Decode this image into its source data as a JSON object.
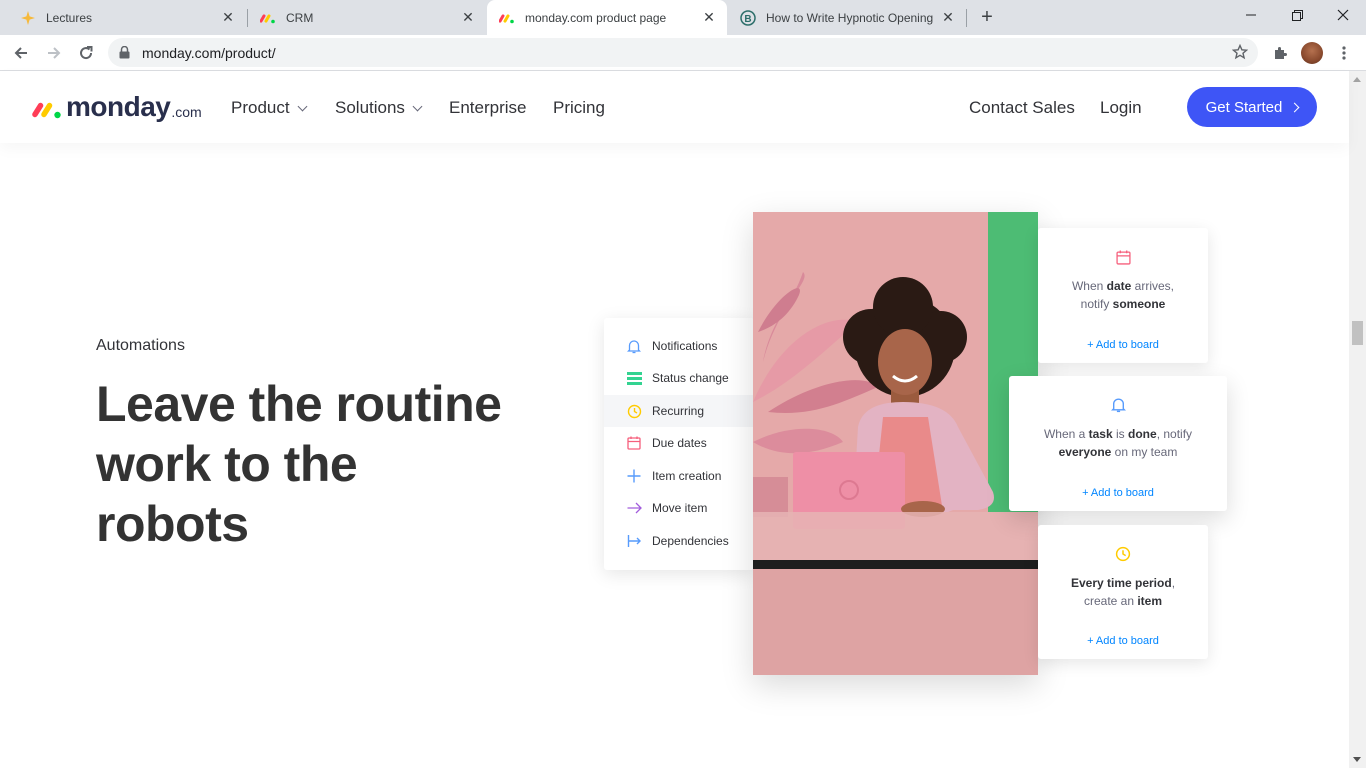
{
  "browser": {
    "tabs": [
      {
        "title": "Lectures",
        "icon": "sparkle-icon"
      },
      {
        "title": "CRM",
        "icon": "monday-favicon"
      },
      {
        "title": "monday.com product page",
        "icon": "monday-favicon",
        "active": true
      },
      {
        "title": "How to Write Hypnotic Opening",
        "icon": "b-circle-favicon"
      }
    ],
    "close_glyph": "✕",
    "new_tab_glyph": "+",
    "url": "monday.com/product/"
  },
  "header": {
    "logo_text": "monday",
    "logo_suffix": ".com",
    "nav": [
      {
        "label": "Product",
        "dropdown": true
      },
      {
        "label": "Solutions",
        "dropdown": true
      },
      {
        "label": "Enterprise"
      },
      {
        "label": "Pricing"
      }
    ],
    "contact_sales": "Contact Sales",
    "login": "Login",
    "cta": "Get Started"
  },
  "hero": {
    "eyebrow": "Automations",
    "headline_lines": [
      "Leave the routine",
      "work to the",
      "robots"
    ]
  },
  "automation_menu": {
    "items": [
      {
        "label": "Notifications",
        "icon": "bell-icon"
      },
      {
        "label": "Status change",
        "icon": "status-lines-icon"
      },
      {
        "label": "Recurring",
        "icon": "clock-icon",
        "selected": true
      },
      {
        "label": "Due dates",
        "icon": "calendar-icon"
      },
      {
        "label": "Item creation",
        "icon": "plus-icon"
      },
      {
        "label": "Move item",
        "icon": "arrow-right-icon"
      },
      {
        "label": "Dependencies",
        "icon": "dependency-icon"
      }
    ]
  },
  "recipes": [
    {
      "icon": "calendar-icon",
      "line1": [
        "When ",
        "date",
        " arrives,"
      ],
      "line2": [
        "notify ",
        "someone",
        ""
      ],
      "link": "+ Add to board"
    },
    {
      "icon": "bell-icon",
      "line1": [
        "When a ",
        "task",
        " is ",
        "done",
        ", notify"
      ],
      "line2": [
        "",
        "everyone",
        " on my team"
      ],
      "link": "+ Add to board"
    },
    {
      "icon": "clock-icon",
      "line1": [
        "",
        "Every time period",
        ","
      ],
      "line2": [
        "create an ",
        "item",
        ""
      ],
      "link": "+ Add to board"
    }
  ],
  "colors": {
    "brand_blue": "#3e55f6",
    "logo_red": "#ff3d57",
    "logo_yellow": "#ffcb00",
    "logo_green": "#00d647",
    "photo_pink": "#e5a9a9",
    "photo_green": "#4dbc74",
    "link_blue": "#0085ff"
  }
}
